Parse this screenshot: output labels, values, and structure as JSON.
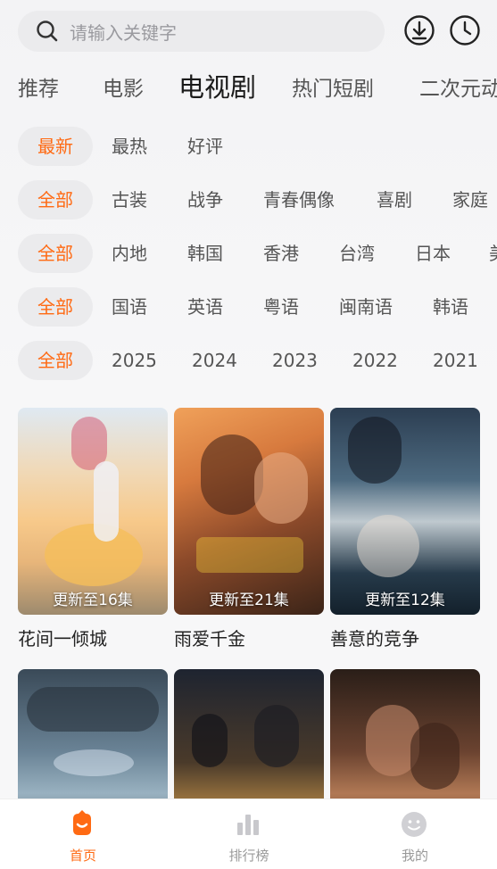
{
  "search": {
    "placeholder": "请输入关键字",
    "icons": [
      "search-icon",
      "download-icon",
      "history-icon"
    ]
  },
  "categories": [
    "推荐",
    "电影",
    "电视剧",
    "热门短剧",
    "二次元动"
  ],
  "active_category": "电视剧",
  "filters": {
    "sort": [
      "最新",
      "最热",
      "好评"
    ],
    "genre": [
      "全部",
      "古装",
      "战争",
      "青春偶像",
      "喜剧",
      "家庭"
    ],
    "region": [
      "全部",
      "内地",
      "韩国",
      "香港",
      "台湾",
      "日本",
      "美"
    ],
    "language": [
      "全部",
      "国语",
      "英语",
      "粤语",
      "闽南语",
      "韩语"
    ],
    "year": [
      "全部",
      "2025",
      "2024",
      "2023",
      "2022",
      "2021"
    ]
  },
  "cards": [
    {
      "title": "花间一倾城",
      "update": "更新至16集"
    },
    {
      "title": "雨爱千金",
      "update": "更新至21集"
    },
    {
      "title": "善意的竞争",
      "update": "更新至12集"
    },
    {
      "title": "",
      "update": ""
    },
    {
      "title": "",
      "update": ""
    },
    {
      "title": "",
      "update": ""
    }
  ],
  "tabbar": [
    {
      "label": "首页",
      "icon": "home-icon"
    },
    {
      "label": "排行榜",
      "icon": "ranking-icon"
    },
    {
      "label": "我的",
      "icon": "profile-icon"
    }
  ],
  "colors": {
    "accent": "#ff6a13",
    "chip": "#ebebed",
    "text": "#555555"
  }
}
